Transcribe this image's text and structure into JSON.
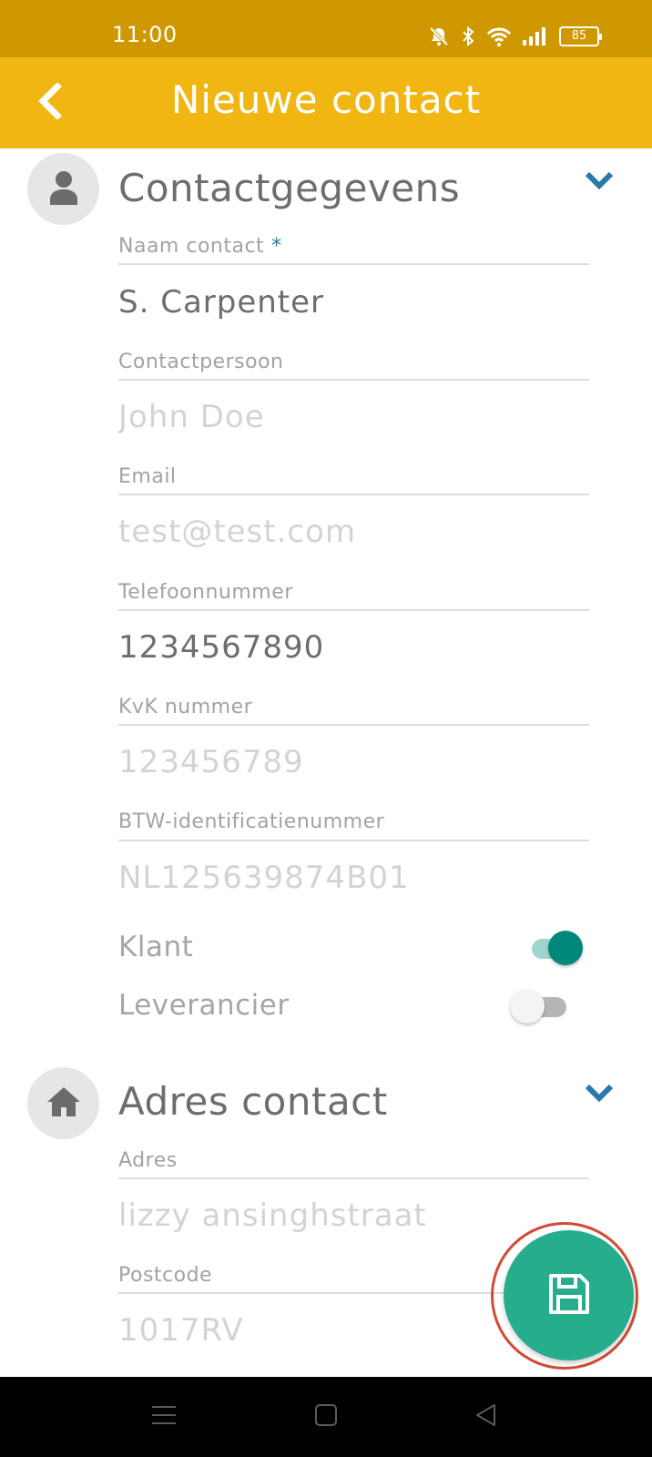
{
  "status_bar": {
    "time": "11:00",
    "battery": "85",
    "icons": [
      "bell-muted-icon",
      "bluetooth-icon",
      "wifi-icon",
      "signal-icon",
      "battery-icon"
    ]
  },
  "header": {
    "title": "Nieuwe contact",
    "back_icon": "chevron-left-icon",
    "background": "#f1b612",
    "status_background": "#cf9700"
  },
  "sections": [
    {
      "title": "Contactgegevens",
      "icon": "person-icon",
      "fields": [
        {
          "label": "Naam contact",
          "required": "*",
          "value": "S. Carpenter",
          "placeholder": ""
        },
        {
          "label": "Contactpersoon",
          "value": "",
          "placeholder": "John Doe"
        },
        {
          "label": "Email",
          "value": "",
          "placeholder": "test@test.com"
        },
        {
          "label": "Telefoonnummer",
          "value": "1234567890",
          "placeholder": ""
        },
        {
          "label": "KvK nummer",
          "value": "",
          "placeholder": "123456789"
        },
        {
          "label": "BTW-identificatienummer",
          "value": "",
          "placeholder": "NL125639874B01"
        }
      ],
      "toggles": [
        {
          "label": "Klant",
          "on": true
        },
        {
          "label": "Leverancier",
          "on": false
        }
      ]
    },
    {
      "title": "Adres contact",
      "icon": "home-icon",
      "fields": [
        {
          "label": "Adres",
          "value": "",
          "placeholder": "lizzy ansinghstraat"
        },
        {
          "label": "Postcode",
          "value": "",
          "placeholder": "1017RV"
        }
      ]
    }
  ],
  "fab": {
    "icon": "save-icon",
    "color": "#26ad8c",
    "highlight_color": "#d04b35"
  },
  "nav_bar": {
    "icons": [
      "menu-icon",
      "home-square-icon",
      "back-triangle-icon"
    ]
  },
  "colors": {
    "accent": "#2a79ab",
    "toggle_on": "#00897b"
  }
}
